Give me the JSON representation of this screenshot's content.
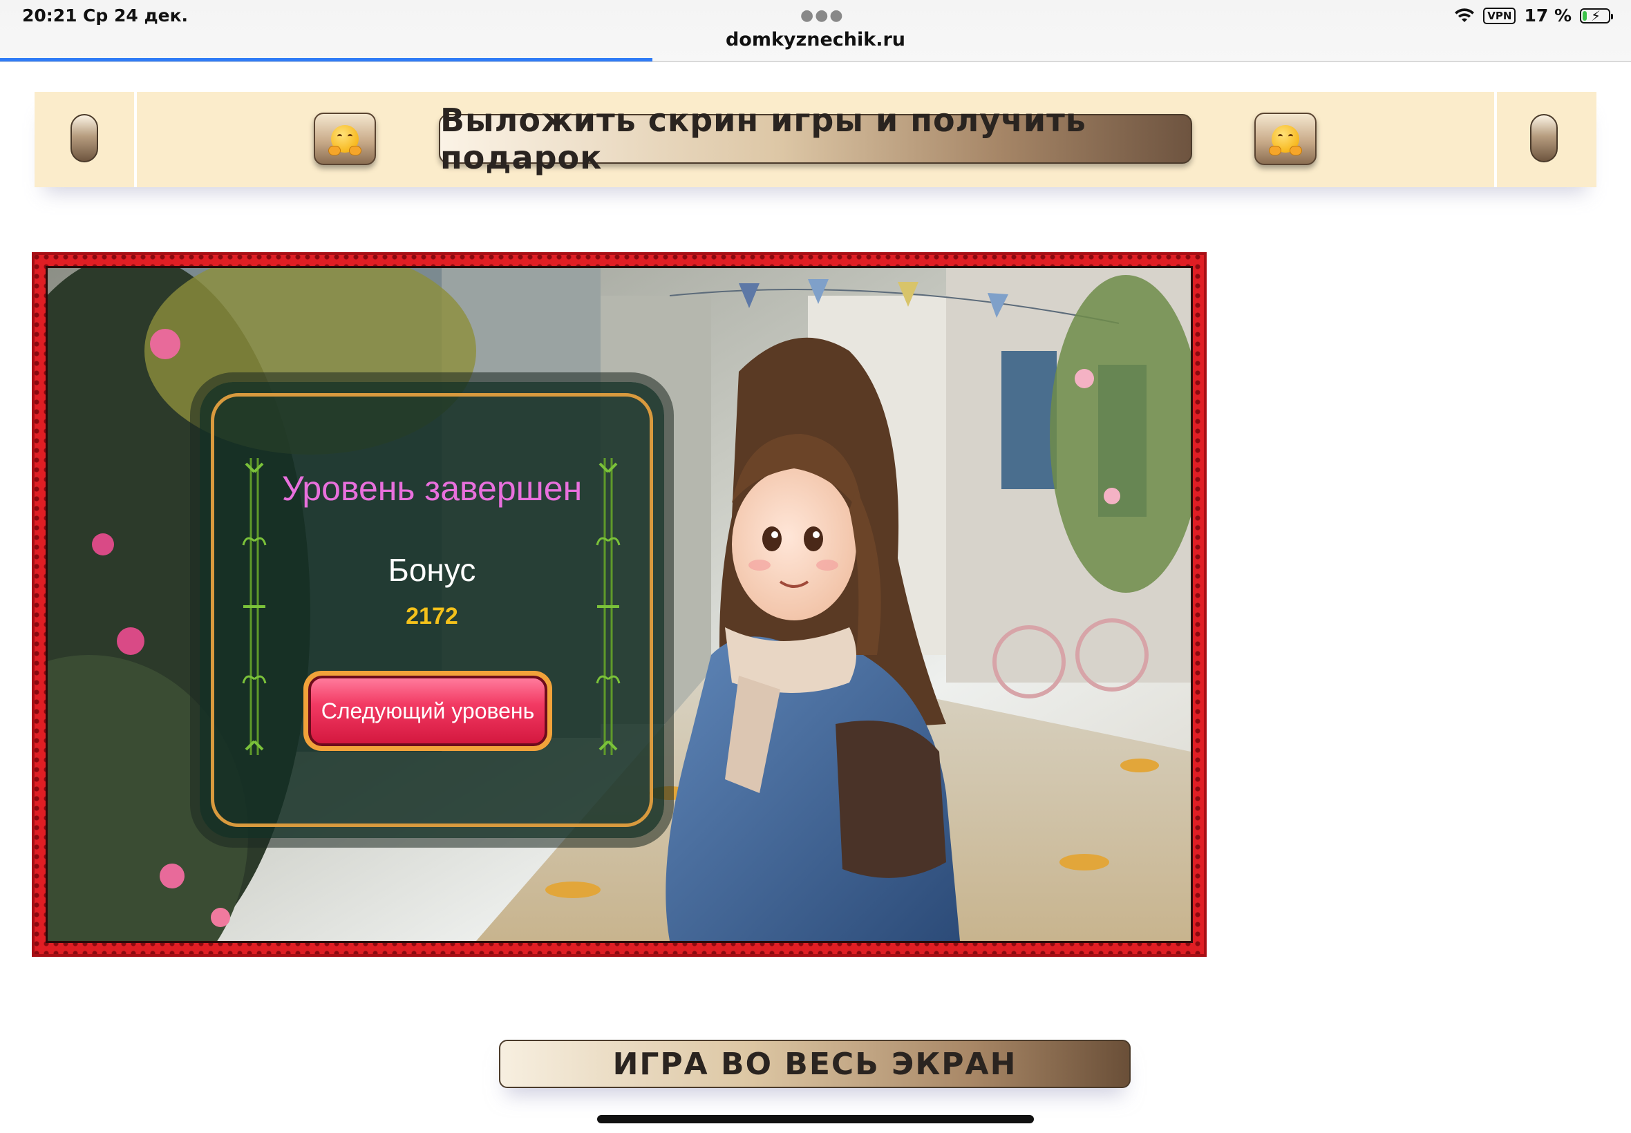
{
  "status_bar": {
    "time": "20:21",
    "date": "Ср 24 дек.",
    "vpn": "VPN",
    "battery_percent": "17 %",
    "battery_level": 0.17
  },
  "browser": {
    "url": "domkyznechik.ru",
    "load_progress": 0.4
  },
  "banner": {
    "gift_label": "Выложить скрин игры и получить подарок",
    "emoji_icon": "hugging-face-icon"
  },
  "game": {
    "level_title": "Уровень завершен",
    "bonus_label": "Бонус",
    "bonus_value": "2172",
    "next_level_label": "Следующий уровень"
  },
  "footer": {
    "fullscreen_label": "ИГРА ВО ВЕСЬ ЭКРАН"
  },
  "colors": {
    "accent_blue": "#2f7bf6",
    "banner_bg": "#fbeccb",
    "frame_red": "#e01e24",
    "title_pink": "#e970dd",
    "bonus_gold": "#f4c11b",
    "button_pink": "#f23a63"
  }
}
